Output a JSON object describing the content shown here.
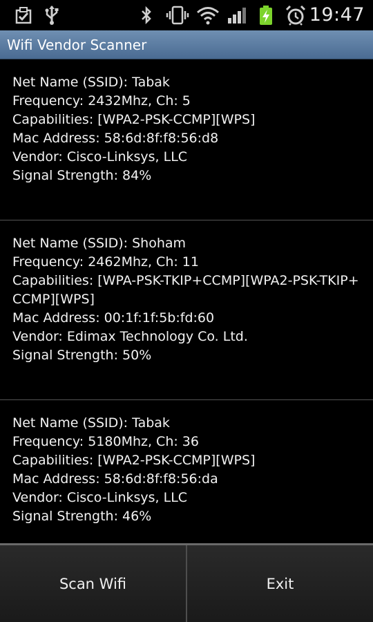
{
  "status_bar": {
    "time": "19:47",
    "icons": [
      "download-done-icon",
      "usb-icon",
      "bluetooth-icon",
      "vibrate-icon",
      "wifi-icon",
      "cell-signal-icon",
      "battery-charging-icon",
      "alarm-icon"
    ],
    "colors": {
      "battery": "#7cd32c",
      "icons": "#d0d0d0"
    }
  },
  "app": {
    "title": "Wifi Vendor Scanner",
    "title_bar_color": "#5a7ba3"
  },
  "networks": [
    {
      "ssid": "Net Name (SSID): Tabak",
      "frequency": "Frequency: 2432Mhz, Ch: 5",
      "capabilities": "Capabilities: [WPA2-PSK-CCMP][WPS]",
      "mac": "Mac Address: 58:6d:8f:f8:56:d8",
      "vendor": "Vendor: Cisco-Linksys, LLC",
      "signal": "Signal Strength: 84%"
    },
    {
      "ssid": "Net Name (SSID): Shoham",
      "frequency": "Frequency: 2462Mhz, Ch: 11",
      "capabilities": "Capabilities: [WPA-PSK-TKIP+CCMP][WPA2-PSK-TKIP+CCMP][WPS]",
      "mac": "Mac Address: 00:1f:1f:5b:fd:60",
      "vendor": "Vendor: Edimax Technology Co. Ltd.",
      "signal": "Signal Strength: 50%"
    },
    {
      "ssid": "Net Name (SSID): Tabak",
      "frequency": "Frequency: 5180Mhz, Ch: 36",
      "capabilities": "Capabilities: [WPA2-PSK-CCMP][WPS]",
      "mac": "Mac Address: 58:6d:8f:f8:56:da",
      "vendor": "Vendor: Cisco-Linksys, LLC",
      "signal": "Signal Strength: 46%"
    }
  ],
  "buttons": {
    "scan_label": "Scan Wifi",
    "exit_label": "Exit"
  }
}
